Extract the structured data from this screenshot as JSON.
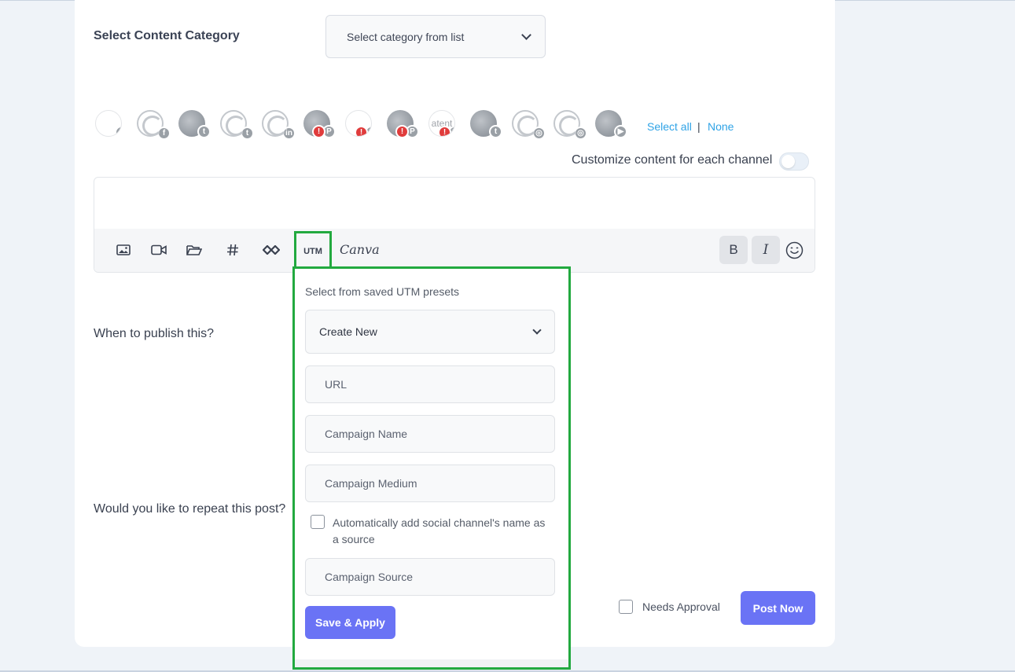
{
  "category": {
    "label": "Select Content Category",
    "placeholder": "Select category from list"
  },
  "channels": [
    {
      "type": "text",
      "text": "",
      "network": "f",
      "warning": false
    },
    {
      "type": "logo",
      "text": "",
      "network": "f",
      "warning": false
    },
    {
      "type": "photo",
      "text": "",
      "network": "t",
      "warning": false
    },
    {
      "type": "logo",
      "text": "",
      "network": "t",
      "warning": false
    },
    {
      "type": "logo",
      "text": "",
      "network": "in",
      "warning": false
    },
    {
      "type": "photo",
      "text": "",
      "network": "P",
      "warning": true
    },
    {
      "type": "text",
      "text": "",
      "network": "P",
      "warning": true
    },
    {
      "type": "photo",
      "text": "",
      "network": "P",
      "warning": true
    },
    {
      "type": "text",
      "text": "atent",
      "network": "P",
      "warning": true
    },
    {
      "type": "photo",
      "text": "",
      "network": "t",
      "warning": false
    },
    {
      "type": "logo",
      "text": "",
      "network": "ig",
      "warning": false
    },
    {
      "type": "logo",
      "text": "",
      "network": "ig",
      "warning": false
    },
    {
      "type": "photo",
      "text": "",
      "network": "yt",
      "warning": false
    }
  ],
  "select": {
    "all": "Select all",
    "separator": "|",
    "none": "None"
  },
  "customize": {
    "label": "Customize content for each channel",
    "enabled": false
  },
  "toolbar": {
    "icons": [
      "image-icon",
      "video-icon",
      "folder-icon",
      "hashtag-icon",
      "link-shortener-icon"
    ],
    "utm": "UTM",
    "canva": "Canva",
    "bold": "B",
    "italic": "I"
  },
  "publish": {
    "question": "When to publish this?"
  },
  "repeat": {
    "question": "Would you like to repeat this post?"
  },
  "utm_panel": {
    "hint": "Select from saved UTM presets",
    "preset_value": "Create New",
    "url_placeholder": "URL",
    "campaign_name_placeholder": "Campaign Name",
    "campaign_medium_placeholder": "Campaign Medium",
    "auto_source_label": "Automatically add social channel's name as a source",
    "campaign_source_placeholder": "Campaign Source",
    "save_label": "Save & Apply"
  },
  "footer": {
    "needs_approval": "Needs Approval",
    "post_now": "Post Now"
  },
  "colors": {
    "accent": "#6a73f5",
    "link": "#2fa3e6",
    "highlight": "#22a93f",
    "warning": "#e03c3c"
  }
}
